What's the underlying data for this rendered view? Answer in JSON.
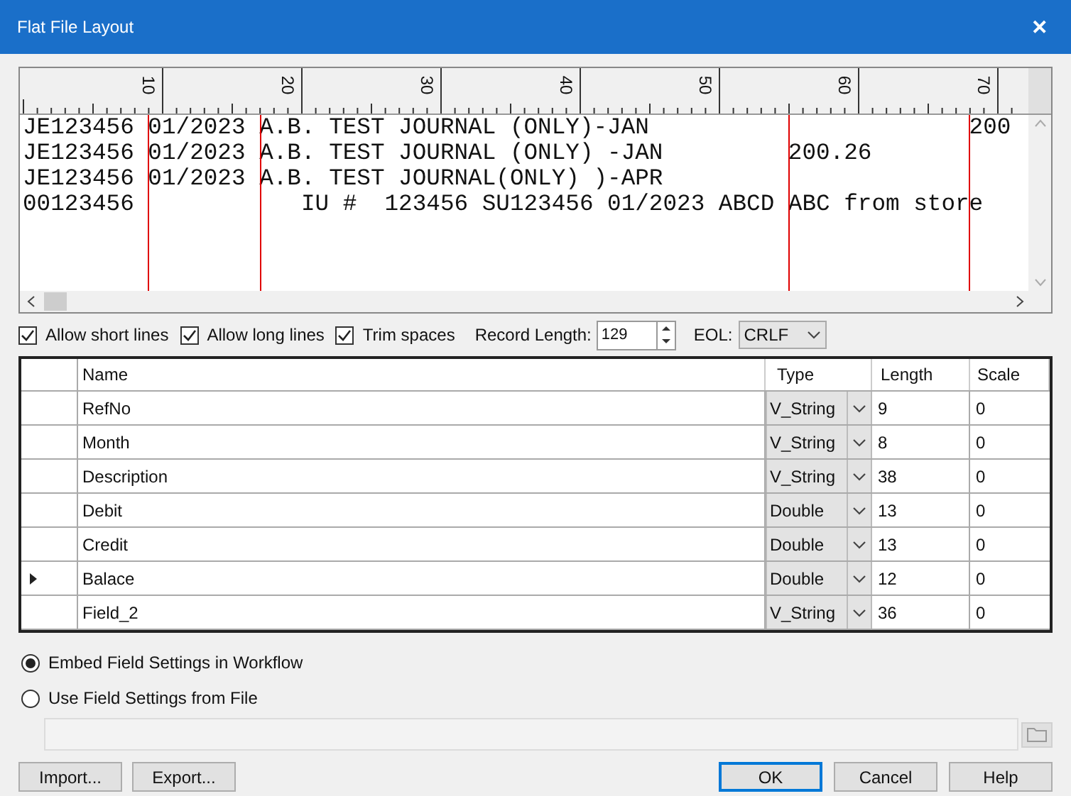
{
  "window": {
    "title": "Flat File Layout",
    "close": "✕"
  },
  "ruler": {
    "labels": [
      "10",
      "20",
      "30",
      "40",
      "50",
      "60",
      "70"
    ]
  },
  "preview_lines": [
    "JE123456 01/2023 A.B. TEST JOURNAL (ONLY)-JAN                       200",
    "JE123456 01/2023 A.B. TEST JOURNAL (ONLY) -JAN         200.26",
    "JE123456 01/2023 A.B. TEST JOURNAL(ONLY) )-APR",
    "00123456            IU #  123456 SU123456 01/2023 ABCD ABC from store"
  ],
  "options": [
    {
      "label": "Allow short lines",
      "checked": true
    },
    {
      "label": "Allow long lines",
      "checked": true
    },
    {
      "label": "Trim spaces",
      "checked": true
    }
  ],
  "record_length": {
    "label": "Record Length:",
    "value": "129"
  },
  "eol": {
    "label": "EOL:",
    "value": "CRLF"
  },
  "table": {
    "columns": [
      "Name",
      "Type",
      "Length",
      "Scale"
    ],
    "rows": [
      {
        "name": "RefNo",
        "type": "V_String",
        "length": "9",
        "scale": "0",
        "current": false
      },
      {
        "name": "Month",
        "type": "V_String",
        "length": "8",
        "scale": "0",
        "current": false
      },
      {
        "name": "Description",
        "type": "V_String",
        "length": "38",
        "scale": "0",
        "current": false
      },
      {
        "name": "Debit",
        "type": "Double",
        "length": "13",
        "scale": "0",
        "current": false
      },
      {
        "name": "Credit",
        "type": "Double",
        "length": "13",
        "scale": "0",
        "current": false
      },
      {
        "name": "Balace",
        "type": "Double",
        "length": "12",
        "scale": "0",
        "current": true
      },
      {
        "name": "Field_2",
        "type": "V_String",
        "length": "36",
        "scale": "0",
        "current": false
      }
    ]
  },
  "settings": [
    {
      "label": "Embed Field Settings in Workflow",
      "selected": true
    },
    {
      "label": "Use Field Settings from File",
      "selected": false
    }
  ],
  "buttons_left": [
    "Import...",
    "Export..."
  ],
  "buttons_right": [
    {
      "label": "OK",
      "default": true
    },
    {
      "label": "Cancel",
      "default": false
    },
    {
      "label": "Help",
      "default": false
    }
  ]
}
